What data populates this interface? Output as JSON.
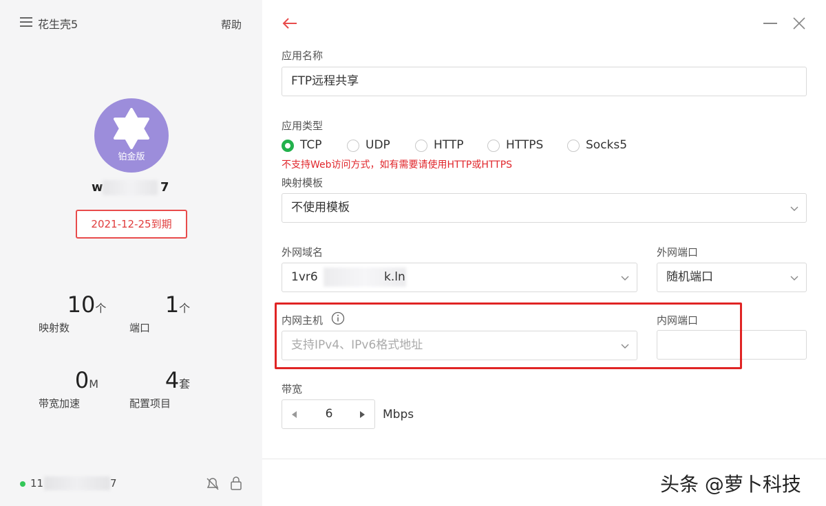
{
  "sidebar": {
    "app_title": "花生壳5",
    "help": "帮助",
    "badge_label": "铂金版",
    "username_start": "w",
    "username_end": "7",
    "expire": "2021-12-25到期",
    "stats": [
      {
        "num": "10",
        "unit": "个",
        "label": "映射数"
      },
      {
        "num": "1",
        "unit": "个",
        "label": "端口"
      },
      {
        "num": "0",
        "unit": "M",
        "label": "带宽加速"
      },
      {
        "num": "4",
        "unit": "套",
        "label": "配置项目"
      }
    ],
    "ip_start": "11",
    "ip_end": "7"
  },
  "form": {
    "app_name_label": "应用名称",
    "app_name_value": "FTP远程共享",
    "app_type_label": "应用类型",
    "app_types": [
      "TCP",
      "UDP",
      "HTTP",
      "HTTPS",
      "Socks5"
    ],
    "app_type_selected": "TCP",
    "warning": "不支持Web访问方式，如有需要请使用HTTP或HTTPS",
    "template_label": "映射模板",
    "template_value": "不使用模板",
    "domain_label": "外网域名",
    "domain_value_start": "1vr6",
    "domain_value_end": "k.ln",
    "ext_port_label": "外网端口",
    "ext_port_value": "随机端口",
    "host_label": "内网主机",
    "host_placeholder": "支持IPv4、IPv6格式地址",
    "int_port_label": "内网端口",
    "int_port_value": "",
    "bandwidth_label": "带宽",
    "bandwidth_value": "6",
    "bandwidth_unit": "Mbps"
  },
  "watermark": "头条 @萝卜科技",
  "colors": {
    "accent_green": "#22b14c",
    "warning_red": "#e0262b",
    "badge_purple": "#9c8ddb",
    "highlight_red": "#e02424"
  }
}
